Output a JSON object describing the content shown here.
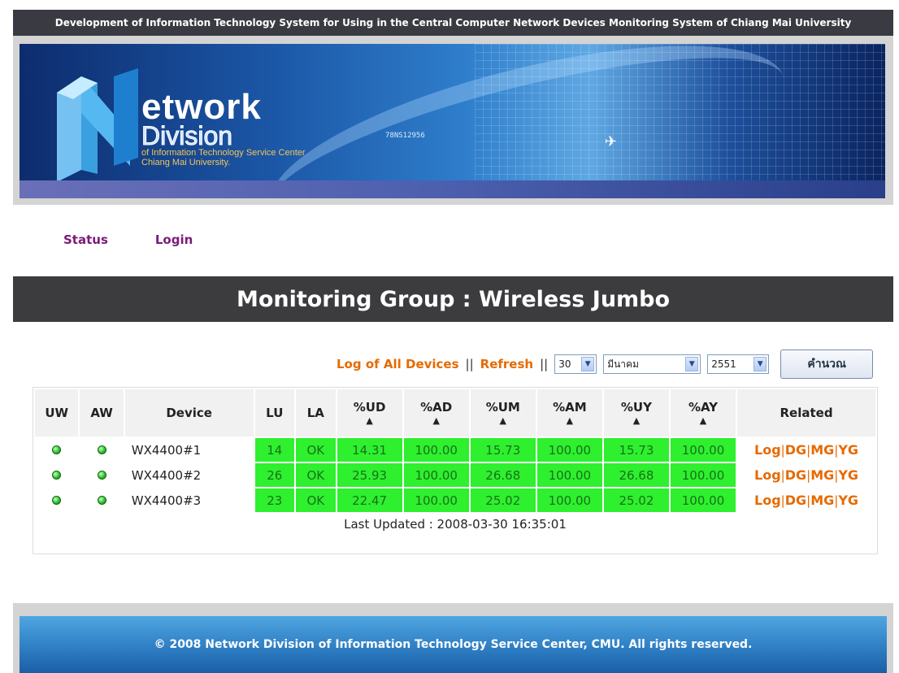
{
  "header": {
    "title": "Development of Information Technology System for Using in the Central Computer Network Devices Monitoring System of Chiang Mai University"
  },
  "banner": {
    "brand_line1": "etwork",
    "brand_line2": "Division",
    "brand_sub1": "of Information Technology Service Center",
    "brand_sub2": "Chiang Mai University.",
    "code_text": "78NS12956"
  },
  "nav": {
    "status": "Status",
    "login": "Login"
  },
  "group": {
    "title": "Monitoring Group : Wireless Jumbo"
  },
  "controls": {
    "log_all": "Log of All Devices",
    "refresh": "Refresh",
    "sep1": "||",
    "sep2": "||",
    "day": "30",
    "month": "มีนาคม",
    "year": "2551",
    "calc_button": "คำนวณ"
  },
  "table": {
    "headers": [
      "UW",
      "AW",
      "Device",
      "LU",
      "LA",
      "%UD",
      "%AD",
      "%UM",
      "%AM",
      "%UY",
      "%AY",
      "Related"
    ],
    "sort_symbol": "▲",
    "rows": [
      {
        "device": "WX4400#1",
        "lu": "14",
        "la": "OK",
        "ud": "14.31",
        "ad": "100.00",
        "um": "15.73",
        "am": "100.00",
        "uy": "15.73",
        "ay": "100.00"
      },
      {
        "device": "WX4400#2",
        "lu": "26",
        "la": "OK",
        "ud": "25.93",
        "ad": "100.00",
        "um": "26.68",
        "am": "100.00",
        "uy": "26.68",
        "ay": "100.00"
      },
      {
        "device": "WX4400#3",
        "lu": "23",
        "la": "OK",
        "ud": "22.47",
        "ad": "100.00",
        "um": "25.02",
        "am": "100.00",
        "uy": "25.02",
        "ay": "100.00"
      }
    ],
    "related_links": [
      "Log",
      "DG",
      "MG",
      "YG"
    ],
    "related_sep": "|",
    "last_updated": "Last Updated : 2008-03-30 16:35:01"
  },
  "footer": {
    "text": "© 2008 Network Division of Information Technology Service Center, CMU. All rights reserved."
  },
  "colors": {
    "accent": "#e66a00",
    "nav_link": "#7c1a78",
    "status_ok": "#2ef02e",
    "title_bar": "#3c3c3f"
  }
}
